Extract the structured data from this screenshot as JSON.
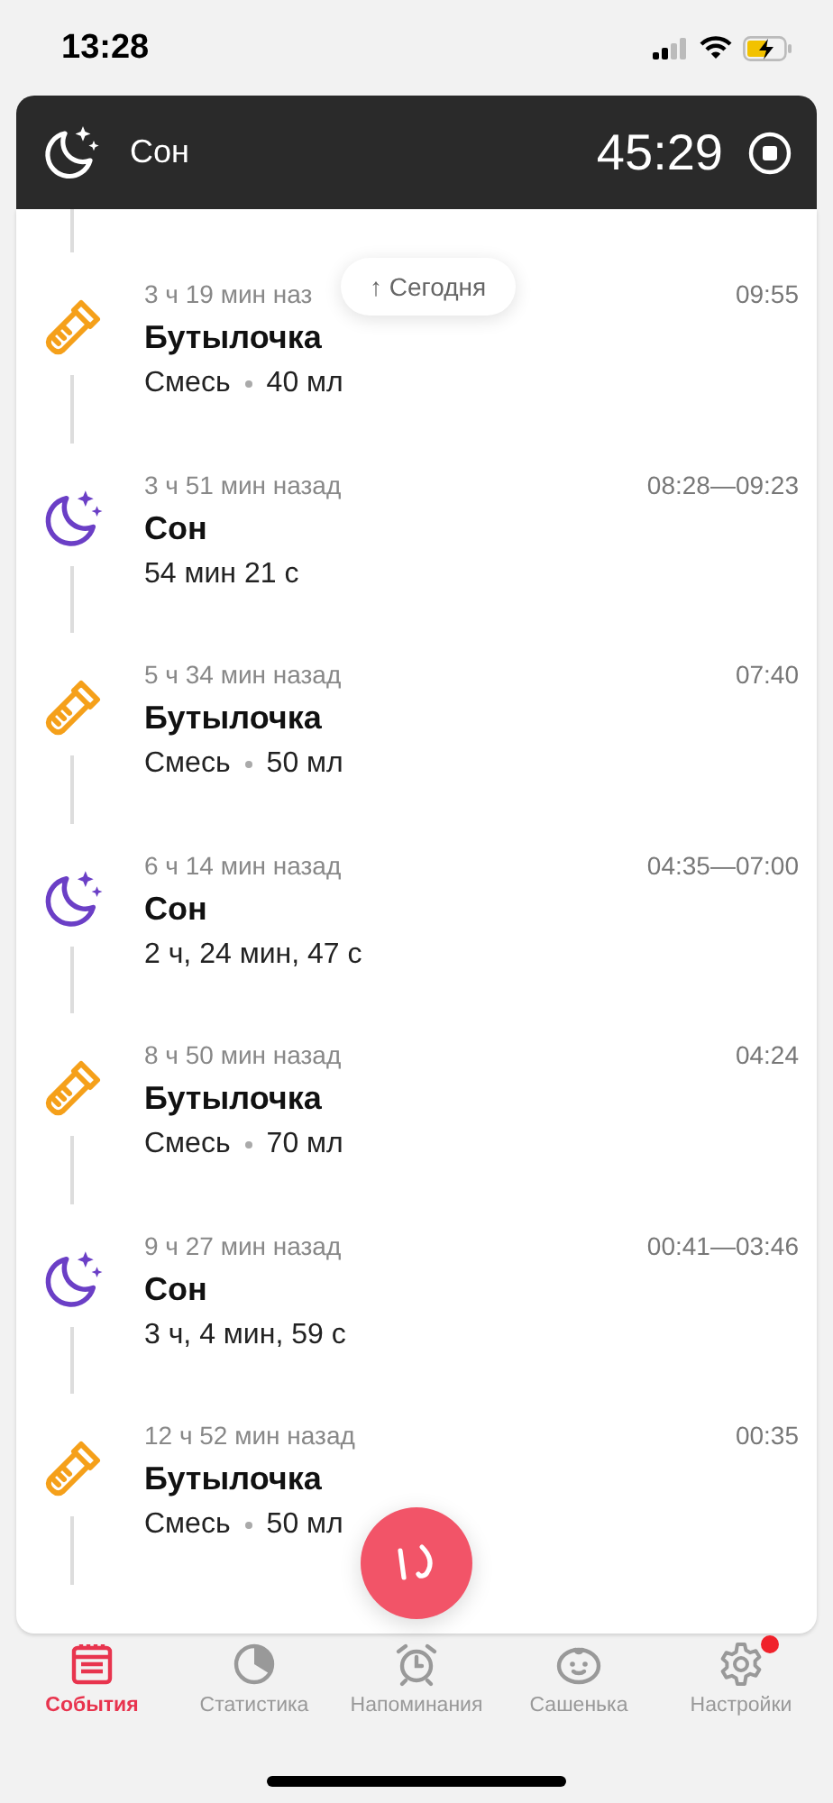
{
  "status_bar": {
    "time": "13:28"
  },
  "active_timer": {
    "label": "Сон",
    "elapsed": "45:29"
  },
  "today_pill": {
    "label": "↑ Сегодня"
  },
  "events": [
    {
      "kind": "feeding",
      "ago": "3 ч 19 мин наз",
      "time": "09:55",
      "title": "Бутылочка",
      "details": [
        "Смесь",
        "40 мл"
      ]
    },
    {
      "kind": "sleep",
      "ago": "3 ч 51 мин назад",
      "time": "08:28—09:23",
      "title": "Сон",
      "details": [
        "54 мин 21 с"
      ]
    },
    {
      "kind": "feeding",
      "ago": "5 ч 34 мин назад",
      "time": "07:40",
      "title": "Бутылочка",
      "details": [
        "Смесь",
        "50 мл"
      ]
    },
    {
      "kind": "sleep",
      "ago": "6 ч 14 мин назад",
      "time": "04:35—07:00",
      "title": "Сон",
      "details": [
        "2 ч, 24 мин, 47 с"
      ]
    },
    {
      "kind": "feeding",
      "ago": "8 ч 50 мин назад",
      "time": "04:24",
      "title": "Бутылочка",
      "details": [
        "Смесь",
        "70 мл"
      ]
    },
    {
      "kind": "sleep",
      "ago": "9 ч 27 мин назад",
      "time": "00:41—03:46",
      "title": "Сон",
      "details": [
        "3 ч, 4 мин, 59 с"
      ]
    },
    {
      "kind": "feeding",
      "ago": "12 ч 52 мин назад",
      "time": "00:35",
      "title": "Бутылочка",
      "details": [
        "Смесь",
        "50 мл"
      ]
    }
  ],
  "tab_bar": [
    {
      "kind": "calendar",
      "label": "События",
      "selected": true,
      "badge": false
    },
    {
      "kind": "stats",
      "label": "Статистика",
      "selected": false,
      "badge": false
    },
    {
      "kind": "alarm",
      "label": "Напоминания",
      "selected": false,
      "badge": false
    },
    {
      "kind": "baby",
      "label": "Сашенька",
      "selected": false,
      "badge": false
    },
    {
      "kind": "settings",
      "label": "Настройки",
      "selected": false,
      "badge": true
    }
  ]
}
